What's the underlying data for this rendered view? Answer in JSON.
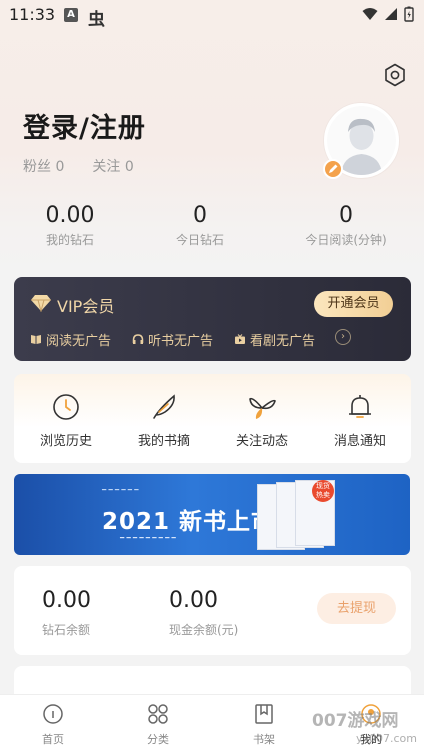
{
  "status_bar": {
    "time": "11:33",
    "a_label": "A",
    "app_glyph": "虫"
  },
  "profile": {
    "login_title": "登录/注册",
    "fans_label": "粉丝",
    "fans_count": "0",
    "following_label": "关注",
    "following_count": "0"
  },
  "stats": [
    {
      "value": "0.00",
      "label": "我的钻石"
    },
    {
      "value": "0",
      "label": "今日钻石"
    },
    {
      "value": "0",
      "label": "今日阅读(分钟)"
    }
  ],
  "vip": {
    "title": "VIP会员",
    "button": "开通会员",
    "features": [
      "阅读无广告",
      "听书无广告",
      "看剧无广告"
    ],
    "accent": "#f0d6a8"
  },
  "menu": [
    {
      "label": "浏览历史",
      "icon": "clock-icon"
    },
    {
      "label": "我的书摘",
      "icon": "feather-icon"
    },
    {
      "label": "关注动态",
      "icon": "leaf-icon"
    },
    {
      "label": "消息通知",
      "icon": "bell-icon"
    }
  ],
  "banner": {
    "text": "2021 新书上市",
    "hot_label": "现货 热卖"
  },
  "wallet": {
    "diamond_balance": "0.00",
    "diamond_label": "钻石余额",
    "cash_balance": "0.00",
    "cash_label": "现金余额(元)",
    "withdraw_button": "去提现"
  },
  "tabbar": [
    {
      "label": "首页",
      "icon": "home-icon"
    },
    {
      "label": "分类",
      "icon": "grid-icon"
    },
    {
      "label": "书架",
      "icon": "bookmark-icon"
    },
    {
      "label": "我的",
      "icon": "user-icon"
    }
  ],
  "watermark": {
    "text": "007游戏网",
    "sub": "yx007.com"
  }
}
